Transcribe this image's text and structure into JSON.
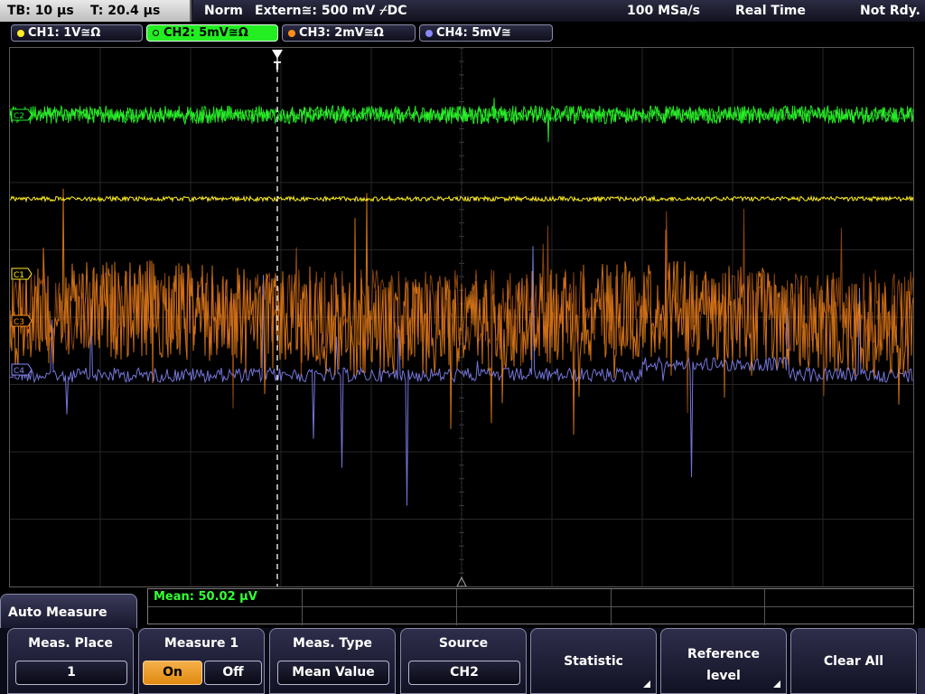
{
  "status": {
    "timebase": "TB: 10 µs",
    "trigger_time": "T: 20.4 µs",
    "mode": "Norm",
    "trigger": "Extern≅: 500 mV ⌿DC",
    "sample_rate": "100 MSa/s",
    "acq_mode": "Real Time",
    "state": "Not Rdy."
  },
  "channels": [
    {
      "label": "CH1: 1V≅Ω",
      "color": "#ffee22",
      "active": false
    },
    {
      "label": "CH2: 5mV≅Ω",
      "color": "#22ee22",
      "active": true
    },
    {
      "label": "CH3: 2mV≅Ω",
      "color": "#ff8c1a",
      "active": false
    },
    {
      "label": "CH4: 5mV≅",
      "color": "#8888ff",
      "active": false
    }
  ],
  "markers": {
    "c2": "C2",
    "c1": "C1",
    "c3": "C3",
    "c4": "C4",
    "trigger": "T"
  },
  "measurement": {
    "result": "Mean: 50.02 µV"
  },
  "menu": {
    "title": "Auto Measure",
    "meas_place": {
      "label": "Meas. Place",
      "value": "1"
    },
    "measure1": {
      "label": "Measure 1",
      "on": "On",
      "off": "Off"
    },
    "meas_type": {
      "label": "Meas. Type",
      "value": "Mean Value"
    },
    "source": {
      "label": "Source",
      "value": "CH2"
    },
    "statistic": {
      "label": "Statistic"
    },
    "reference": {
      "label1": "Reference",
      "label2": "level"
    },
    "clear_all": {
      "label": "Clear All"
    }
  }
}
